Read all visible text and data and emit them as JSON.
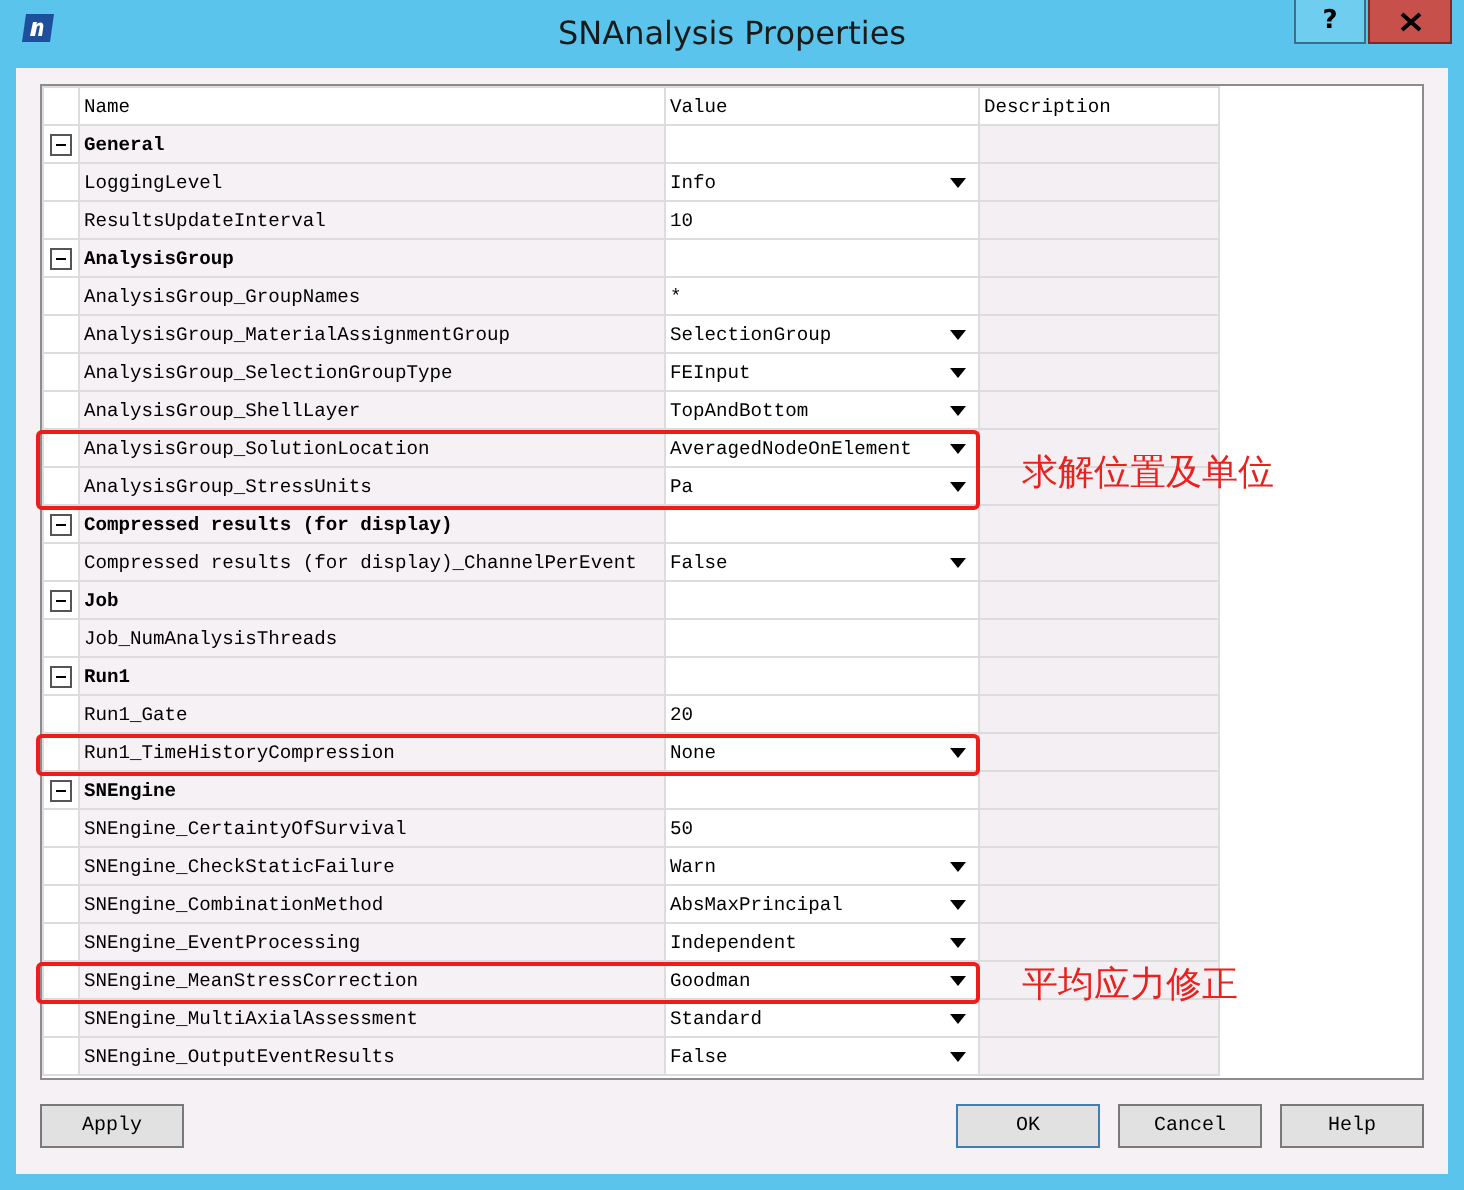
{
  "window": {
    "title": "SNAnalysis Properties",
    "help_button": "?"
  },
  "columns": [
    "Name",
    "Value",
    "Description"
  ],
  "groups": [
    {
      "name": "General",
      "expanded": true,
      "properties": [
        {
          "name": "LoggingLevel",
          "value": "Info",
          "dropdown": true,
          "highlighted": false
        },
        {
          "name": "ResultsUpdateInterval",
          "value": "10",
          "dropdown": false,
          "highlighted": false
        }
      ]
    },
    {
      "name": "AnalysisGroup",
      "expanded": true,
      "properties": [
        {
          "name": "AnalysisGroup_GroupNames",
          "value": "*",
          "dropdown": false,
          "highlighted": false
        },
        {
          "name": "AnalysisGroup_MaterialAssignmentGroup",
          "value": "SelectionGroup",
          "dropdown": true,
          "highlighted": false
        },
        {
          "name": "AnalysisGroup_SelectionGroupType",
          "value": "FEInput",
          "dropdown": true,
          "highlighted": false
        },
        {
          "name": "AnalysisGroup_ShellLayer",
          "value": "TopAndBottom",
          "dropdown": true,
          "highlighted": false
        },
        {
          "name": "AnalysisGroup_SolutionLocation",
          "value": "AveragedNodeOnElement",
          "dropdown": true,
          "highlighted": true,
          "note": "求解位置及单位"
        },
        {
          "name": "AnalysisGroup_StressUnits",
          "value": "Pa",
          "dropdown": true,
          "highlighted": true
        }
      ]
    },
    {
      "name": "Compressed results (for display)",
      "expanded": true,
      "properties": [
        {
          "name": "Compressed results (for display)_ChannelPerEvent",
          "value": "False",
          "dropdown": true,
          "highlighted": false
        }
      ]
    },
    {
      "name": "Job",
      "expanded": true,
      "properties": [
        {
          "name": "Job_NumAnalysisThreads",
          "dropdown": false,
          "highlighted": false
        }
      ]
    },
    {
      "name": "Run1",
      "expanded": true,
      "properties": [
        {
          "name": "Run1_Gate",
          "value": "20",
          "dropdown": false,
          "highlighted": false
        },
        {
          "name": "Run1_TimeHistoryCompression",
          "value": "None",
          "dropdown": true,
          "highlighted": true
        }
      ]
    },
    {
      "name": "SNEngine",
      "expanded": true,
      "properties": [
        {
          "name": "SNEngine_CertaintyOfSurvival",
          "value": "50",
          "dropdown": false,
          "highlighted": false
        },
        {
          "name": "SNEngine_CheckStaticFailure",
          "value": "Warn",
          "dropdown": true,
          "highlighted": false
        },
        {
          "name": "SNEngine_CombinationMethod",
          "value": "AbsMaxPrincipal",
          "dropdown": true,
          "highlighted": false
        },
        {
          "name": "SNEngine_EventProcessing",
          "value": "Independent",
          "dropdown": true,
          "highlighted": false
        },
        {
          "name": "SNEngine_MeanStressCorrection",
          "value": "Goodman",
          "dropdown": true,
          "highlighted": true,
          "note": "平均应力修正"
        },
        {
          "name": "SNEngine_MultiAxialAssessment",
          "value": "Standard",
          "dropdown": true,
          "highlighted": false
        },
        {
          "name": "SNEngine_OutputEventResults",
          "value": "False",
          "dropdown": true,
          "highlighted": false
        }
      ]
    }
  ],
  "buttons": {
    "left": [
      "Apply"
    ],
    "right": [
      {
        "label": "OK",
        "default": true
      },
      {
        "label": "Cancel",
        "default": false
      },
      {
        "label": "Help",
        "default": false
      }
    ]
  }
}
